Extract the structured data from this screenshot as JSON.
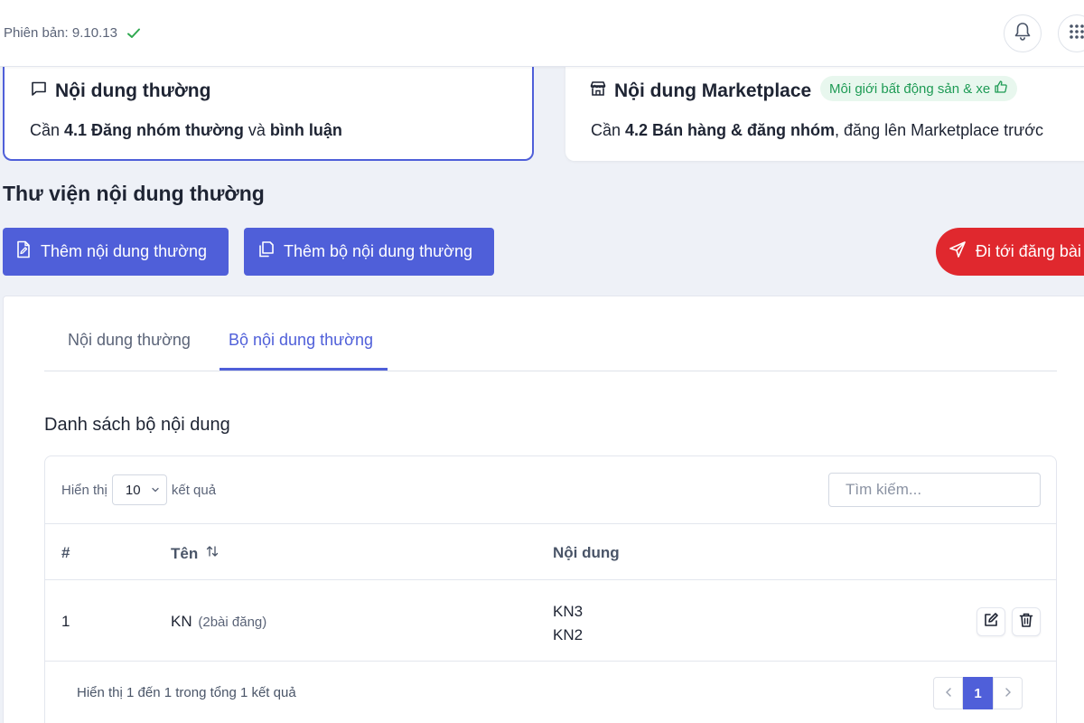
{
  "header": {
    "version_label": "Phiên bản: 9.10.13",
    "icons": [
      "check-icon",
      "bell-icon",
      "apps-grid-icon"
    ]
  },
  "cards": {
    "normal": {
      "title": "Nội dung thường",
      "desc_prefix": "Cần ",
      "desc_bold1": "4.1 Đăng nhóm thường",
      "desc_mid": " và ",
      "desc_bold2": "bình luận",
      "icon": "message-square-icon"
    },
    "marketplace": {
      "title": "Nội dung Marketplace",
      "badge": "Môi giới bất động sản & xe",
      "desc_prefix": "Cần ",
      "desc_bold": "4.2 Bán hàng & đăng nhóm",
      "desc_suffix": ", đăng lên Marketplace trước",
      "icon": "store-icon"
    }
  },
  "library": {
    "title": "Thư viện nội dung thường",
    "add_button": "Thêm nội dung thường",
    "add_set_button": "Thêm bộ nội dung thường",
    "goto_button": "Đi tới đăng bài"
  },
  "tabs": [
    "Nội dung thường",
    "Bộ nội dung thường"
  ],
  "active_tab": "Bộ nội dung thường",
  "list": {
    "title": "Danh sách bộ nội dung",
    "show_label": "Hiển thị",
    "page_size": "10",
    "results_label": "kết quả",
    "search_placeholder": "Tìm kiếm...",
    "columns": [
      "#",
      "Tên",
      "Nội dung"
    ],
    "rows": [
      {
        "num": "1",
        "name": "KN",
        "post_count": "(2bài đăng)",
        "content_line1": "KN3",
        "content_line2": "KN2"
      }
    ],
    "summary": "Hiển thị 1 đến 1 trong tổng 1 kết quả",
    "current_page": "1"
  },
  "colors": {
    "primary": "#4f5fd9",
    "danger": "#e0282e",
    "success": "#2fa84f",
    "badge_bg": "#e8f7ee"
  }
}
